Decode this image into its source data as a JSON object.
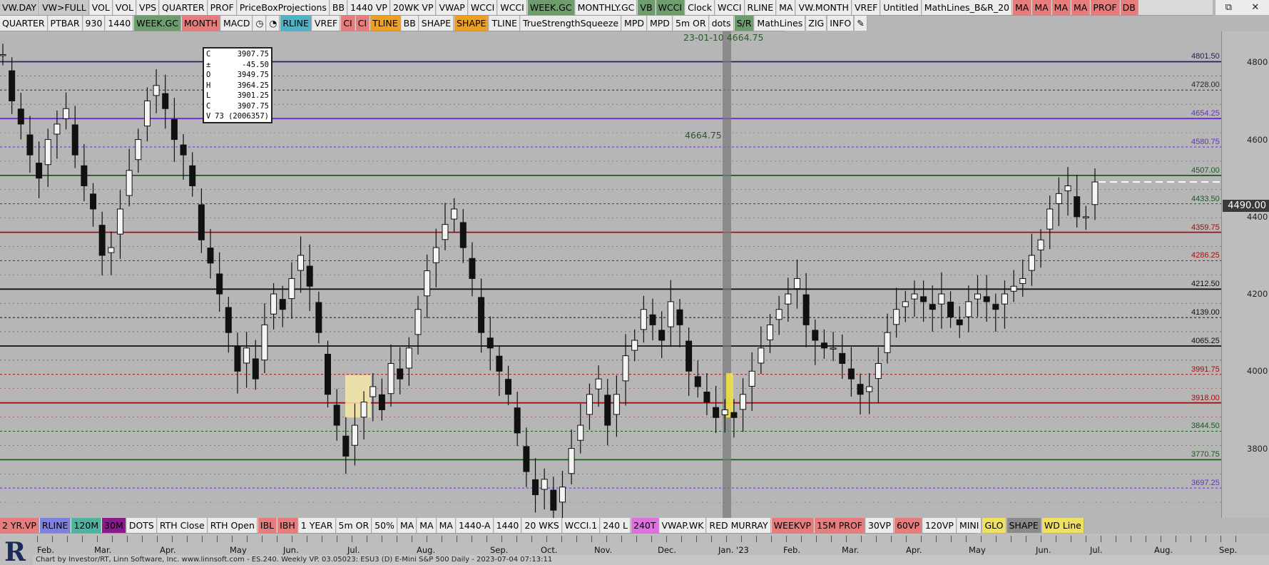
{
  "toolbar_top": [
    {
      "label": "VW.DAY",
      "color": "#c8c8c8"
    },
    {
      "label": "VW>FULL",
      "color": "#c8c8c8"
    },
    {
      "label": "VOL",
      "color": ""
    },
    {
      "label": "VOL",
      "color": ""
    },
    {
      "label": "VPS",
      "color": ""
    },
    {
      "label": "QUARTER",
      "color": ""
    },
    {
      "label": "PROF",
      "color": ""
    },
    {
      "label": "PriceBoxProjections",
      "color": ""
    },
    {
      "label": "BB",
      "color": ""
    },
    {
      "label": "1440 VP",
      "color": ""
    },
    {
      "label": "20WK VP",
      "color": ""
    },
    {
      "label": "VWAP",
      "color": ""
    },
    {
      "label": "WCCI",
      "color": ""
    },
    {
      "label": "WCCI",
      "color": ""
    },
    {
      "label": "WEEK.GC",
      "color": "#6d9c6d"
    },
    {
      "label": "MONTHLY.GC",
      "color": ""
    },
    {
      "label": "VB",
      "color": "#6d9c6d"
    },
    {
      "label": "WCCI",
      "color": "#6d9c6d"
    },
    {
      "label": "Clock",
      "color": ""
    },
    {
      "label": "WCCI",
      "color": ""
    },
    {
      "label": "RLINE",
      "color": ""
    },
    {
      "label": "MA",
      "color": ""
    },
    {
      "label": "VW.MONTH",
      "color": ""
    },
    {
      "label": "VREF",
      "color": ""
    },
    {
      "label": "Untitled",
      "color": ""
    },
    {
      "label": "MathLines_B&R_20",
      "color": ""
    },
    {
      "label": "MA",
      "color": "#e87c7c"
    },
    {
      "label": "MA",
      "color": "#e87c7c"
    },
    {
      "label": "MA",
      "color": "#e87c7c"
    },
    {
      "label": "MA",
      "color": "#e87c7c"
    },
    {
      "label": "PROF",
      "color": "#e87c7c"
    },
    {
      "label": "DB",
      "color": "#e87c7c"
    }
  ],
  "toolbar_second": [
    {
      "label": "QUARTER",
      "color": ""
    },
    {
      "label": "PTBAR",
      "color": ""
    },
    {
      "label": "930",
      "color": ""
    },
    {
      "label": "1440",
      "color": ""
    },
    {
      "label": "WEEK.GC",
      "color": "#6d9c6d"
    },
    {
      "label": "MONTH",
      "color": "#e87c7c"
    },
    {
      "label": "MACD",
      "color": ""
    },
    {
      "label": "◷",
      "color": ""
    },
    {
      "label": "◔",
      "color": ""
    },
    {
      "label": "RLINE",
      "color": "#4fb3c7"
    },
    {
      "label": "VREF",
      "color": ""
    },
    {
      "label": "CI",
      "color": "#e87c7c"
    },
    {
      "label": "CI",
      "color": "#e87c7c"
    },
    {
      "label": "TLINE",
      "color": "#f0a020"
    },
    {
      "label": "BB",
      "color": ""
    },
    {
      "label": "SHAPE",
      "color": ""
    },
    {
      "label": "SHAPE",
      "color": "#f0a020"
    },
    {
      "label": "TLINE",
      "color": ""
    },
    {
      "label": "TrueStrengthSqueeze",
      "color": ""
    },
    {
      "label": "MPD",
      "color": ""
    },
    {
      "label": "MPD",
      "color": ""
    },
    {
      "label": "5m OR",
      "color": ""
    },
    {
      "label": "dots",
      "color": ""
    },
    {
      "label": "S/R",
      "color": "#6d9c6d"
    },
    {
      "label": "MathLines",
      "color": ""
    },
    {
      "label": "ZIG",
      "color": ""
    },
    {
      "label": "INFO",
      "color": ""
    },
    {
      "label": "✎",
      "color": ""
    }
  ],
  "toolbar_bottom": [
    {
      "label": "2 YR.VP",
      "color": "#e87c7c"
    },
    {
      "label": "RLINE",
      "color": "#7f7fe0"
    },
    {
      "label": "120M",
      "color": "#4fb3a0"
    },
    {
      "label": "30M",
      "color": "#8b1a8b"
    },
    {
      "label": "DOTS",
      "color": ""
    },
    {
      "label": "RTH Close",
      "color": ""
    },
    {
      "label": "RTH Open",
      "color": ""
    },
    {
      "label": "IBL",
      "color": "#e87c7c"
    },
    {
      "label": "IBH",
      "color": "#e87c7c"
    },
    {
      "label": "1 YEAR",
      "color": ""
    },
    {
      "label": "5m OR",
      "color": ""
    },
    {
      "label": "50%",
      "color": ""
    },
    {
      "label": "MA",
      "color": ""
    },
    {
      "label": "MA",
      "color": ""
    },
    {
      "label": "MA",
      "color": ""
    },
    {
      "label": "1440-A",
      "color": ""
    },
    {
      "label": "1440",
      "color": ""
    },
    {
      "label": "20 WKS",
      "color": ""
    },
    {
      "label": "WCCI.1",
      "color": ""
    },
    {
      "label": "240 L",
      "color": ""
    },
    {
      "label": "240T",
      "color": "#e070e0"
    },
    {
      "label": "VWAP.WK",
      "color": ""
    },
    {
      "label": "RED MURRAY",
      "color": ""
    },
    {
      "label": "WEEKVP",
      "color": "#e87c7c"
    },
    {
      "label": "15M PROF",
      "color": "#e87c7c"
    },
    {
      "label": "30VP",
      "color": ""
    },
    {
      "label": "60VP",
      "color": "#e87c7c"
    },
    {
      "label": "120VP",
      "color": ""
    },
    {
      "label": "MINI",
      "color": ""
    },
    {
      "label": "GLO",
      "color": "#f0e060"
    },
    {
      "label": "SHAPE",
      "color": "#8a8a8a"
    },
    {
      "label": "WD Line",
      "color": "#f0e060"
    }
  ],
  "window_controls": [
    "⧉",
    "✕"
  ],
  "ohlc_box": [
    {
      "k": "C",
      "v": "3907.75"
    },
    {
      "k": "±",
      "v": "-45.50"
    },
    {
      "k": "O",
      "v": "3949.75"
    },
    {
      "k": "H",
      "v": "3964.25"
    },
    {
      "k": "L",
      "v": "3901.25"
    },
    {
      "k": "C",
      "v": "3907.75"
    },
    {
      "k": "V",
      "v": "73 (2006357)"
    }
  ],
  "cursor_readout": "23-01-10 4664.75",
  "mid_label": "4664.75",
  "price_badge": "4490.00",
  "level_labels": [
    {
      "price": 4801.5,
      "text": "4801.50",
      "color": "#2a1a5a"
    },
    {
      "price": 4728.0,
      "text": "4728.00",
      "color": "#2a2a2a"
    },
    {
      "price": 4654.25,
      "text": "4654.25",
      "color": "#6a2ad0"
    },
    {
      "price": 4580.75,
      "text": "4580.75",
      "color": "#6a2ad0"
    },
    {
      "price": 4507.0,
      "text": "4507.00",
      "color": "#1a5a1a"
    },
    {
      "price": 4433.5,
      "text": "4433.50",
      "color": "#1a5a1a"
    },
    {
      "price": 4359.75,
      "text": "4359.75",
      "color": "#a01010"
    },
    {
      "price": 4286.25,
      "text": "4286.25",
      "color": "#a01010"
    },
    {
      "price": 4212.5,
      "text": "4212.50",
      "color": "#111111"
    },
    {
      "price": 4139.0,
      "text": "4139.00",
      "color": "#111111"
    },
    {
      "price": 4065.25,
      "text": "4065.25",
      "color": "#111111"
    },
    {
      "price": 3991.75,
      "text": "3991.75",
      "color": "#a01010"
    },
    {
      "price": 3918.0,
      "text": "3918.00",
      "color": "#a01010"
    },
    {
      "price": 3844.5,
      "text": "3844.50",
      "color": "#1a5a1a"
    },
    {
      "price": 3770.75,
      "text": "3770.75",
      "color": "#1a5a1a"
    },
    {
      "price": 3697.25,
      "text": "3697.25",
      "color": "#6a2ad0"
    }
  ],
  "y_ticks": [
    "4800",
    "4600",
    "4400",
    "4200",
    "4000",
    "3800"
  ],
  "x_months": [
    "Feb.",
    "Mar.",
    "Apr.",
    "May",
    "Jun.",
    "Jul.",
    "Aug.",
    "Sep.",
    "Oct.",
    "Nov.",
    "Dec.",
    "Jan. '23",
    "Feb.",
    "Mar.",
    "Apr.",
    "May",
    "Jun.",
    "Jul.",
    "Aug.",
    "Sep."
  ],
  "footer": "Chart by Investor/RT, Linn Software, Inc. www.linnsoft.com - ES.240.   Weekly VP.   03.05023: ESU3 (D) E-Mini S&P 500 Daily - 2023-07-04 07:13:11",
  "chart_data": {
    "type": "candlestick",
    "title": "ESU3 (D) E-Mini S&P 500 Daily",
    "ylim": [
      3620,
      4880
    ],
    "grid": false,
    "last_price": 4490.0,
    "series": [
      {
        "name": "closes",
        "values": [
          4820,
          4700,
          4640,
          4560,
          4500,
          4600,
          4640,
          4680,
          4560,
          4480,
          4420,
          4300,
          4320,
          4420,
          4520,
          4600,
          4700,
          4740,
          4680,
          4600,
          4560,
          4480,
          4340,
          4280,
          4200,
          4100,
          4000,
          4060,
          3980,
          4120,
          4200,
          4160,
          4240,
          4300,
          4220,
          4100,
          3940,
          3860,
          3780,
          3860,
          3920,
          3960,
          3900,
          4020,
          3980,
          4060,
          4160,
          4260,
          4320,
          4380,
          4420,
          4320,
          4240,
          4100,
          4060,
          4000,
          3940,
          3840,
          3740,
          3680,
          3720,
          3640,
          3700,
          3800,
          3860,
          3940,
          3980,
          3860,
          3940,
          4040,
          4080,
          4160,
          4120,
          4080,
          4180,
          4120,
          4000,
          3960,
          3920,
          3880,
          3900,
          3880,
          3940,
          4000,
          4060,
          4120,
          4160,
          4200,
          4240,
          4120,
          4080,
          4060,
          4060,
          4020,
          3980,
          3940,
          3960,
          4020,
          4100,
          4160,
          4180,
          4200,
          4180,
          4160,
          4200,
          4140,
          4120,
          4180,
          4200,
          4180,
          4160,
          4200,
          4220,
          4240,
          4300,
          4340,
          4420,
          4460,
          4480,
          4400,
          4400,
          4490
        ]
      }
    ]
  }
}
